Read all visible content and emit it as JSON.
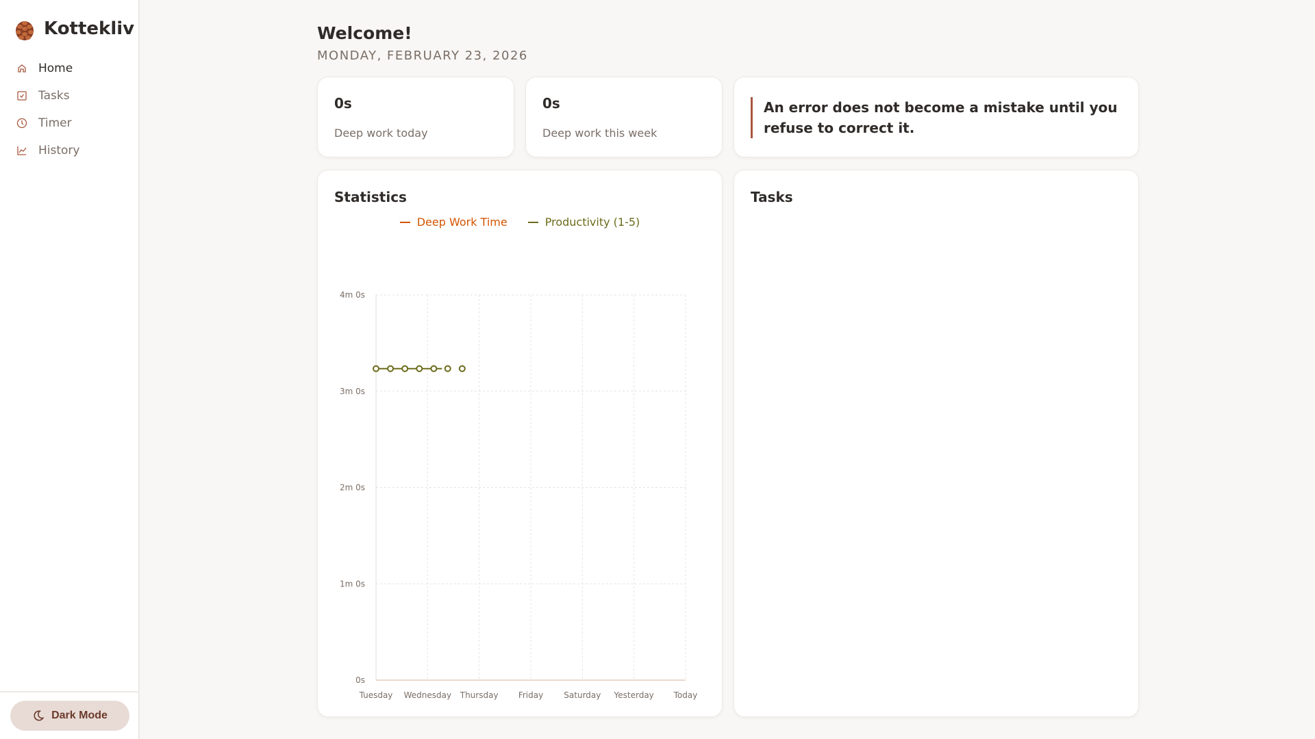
{
  "app": {
    "name": "Kottekliv"
  },
  "sidebar": {
    "items": [
      {
        "label": "Home",
        "icon": "home-icon"
      },
      {
        "label": "Tasks",
        "icon": "check-square-icon"
      },
      {
        "label": "Timer",
        "icon": "clock-icon"
      },
      {
        "label": "History",
        "icon": "chart-line-icon"
      }
    ],
    "dark_mode_label": "Dark Mode"
  },
  "header": {
    "title": "Welcome!",
    "date": "MONDAY, FEBRUARY 23, 2026"
  },
  "stats": [
    {
      "value": "0s",
      "label": "Deep work today"
    },
    {
      "value": "0s",
      "label": "Deep work this week"
    }
  ],
  "quote": "An error does not become a mistake until you refuse to correct it.",
  "statistics": {
    "title": "Statistics"
  },
  "tasks": {
    "title": "Tasks"
  },
  "colors": {
    "accent": "#a8573f",
    "deep_work": "#d35400",
    "productivity": "#6b6b1a"
  },
  "chart_data": {
    "type": "line",
    "categories": [
      "Tuesday",
      "Wednesday",
      "Thursday",
      "Friday",
      "Saturday",
      "Yesterday",
      "Today"
    ],
    "yticks": [
      "0s",
      "1m 0s",
      "2m 0s",
      "3m 0s",
      "4m 0s"
    ],
    "ylim": [
      0,
      4
    ],
    "y2lim": [
      0,
      3.71
    ],
    "grid": true,
    "legend_position": "top-center",
    "series": [
      {
        "name": "Deep Work Time",
        "color": "#d35400",
        "values": [
          0,
          0,
          0,
          0,
          0,
          0,
          0
        ]
      },
      {
        "name": "Productivity (1-5)",
        "color": "#6b6b1a",
        "x": [
          0,
          0.28,
          0.56,
          0.84,
          1.12,
          1.39,
          1.67
        ],
        "values": [
          3,
          3,
          3,
          3,
          3,
          3,
          3
        ],
        "connected": [
          true,
          true,
          true,
          true,
          false,
          false
        ]
      }
    ]
  }
}
